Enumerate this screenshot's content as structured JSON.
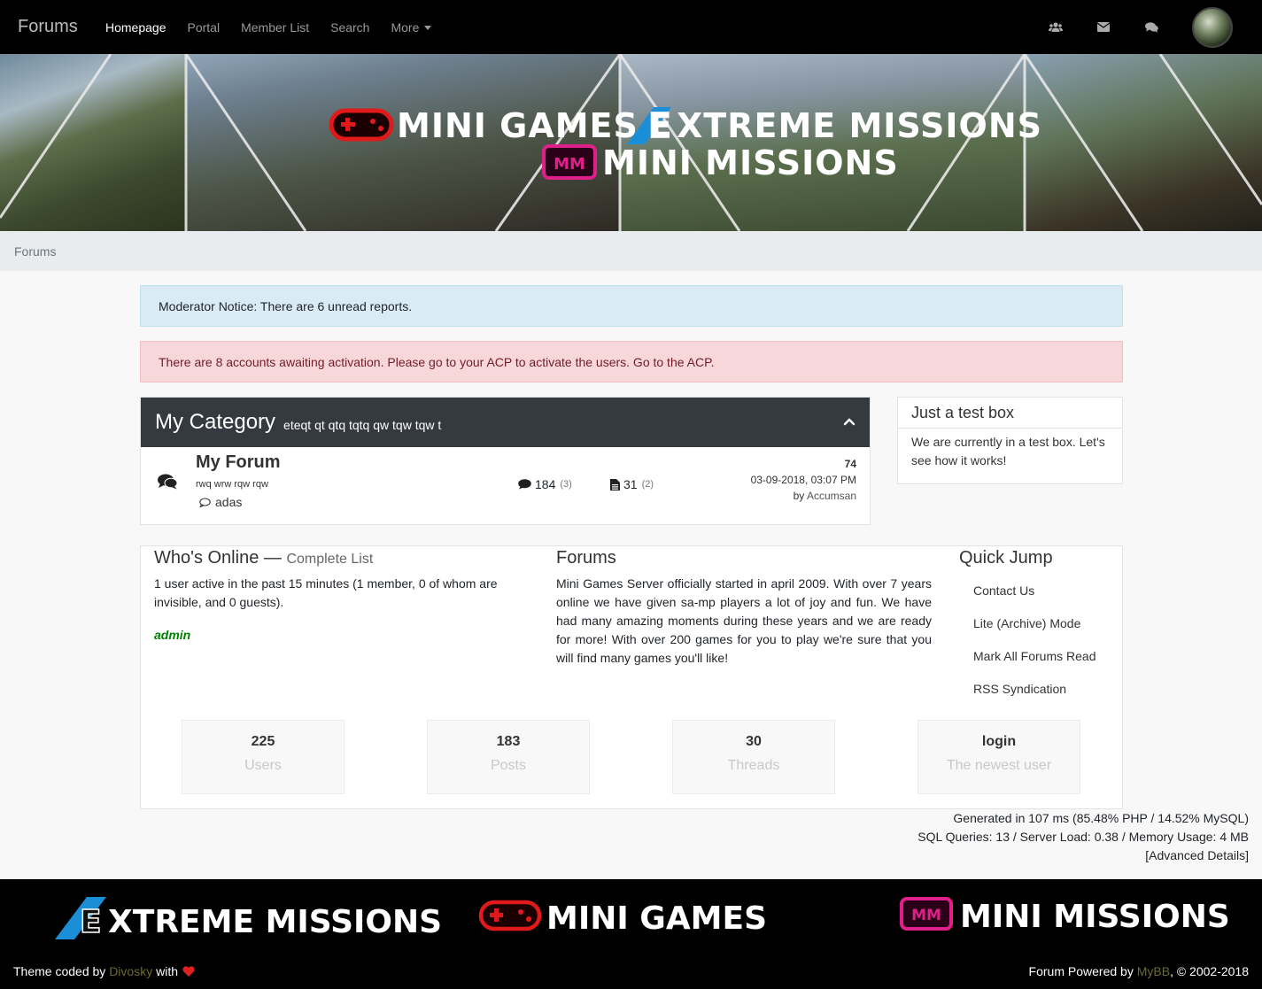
{
  "navbar": {
    "brand": "Forums",
    "links": [
      {
        "label": "Homepage",
        "active": true
      },
      {
        "label": "Portal"
      },
      {
        "label": "Member List"
      },
      {
        "label": "Search"
      },
      {
        "label": "More"
      }
    ],
    "icons": [
      "users-icon",
      "envelope-icon",
      "comments-icon"
    ]
  },
  "banner": {
    "line1_left": "MINI GAMES",
    "line1_right": "XTREME MISSIONS",
    "line1_right_initial": "E",
    "line2": "MINI MISSIONS",
    "mm_badge": "MM"
  },
  "breadcrumb": "Forums",
  "alerts": {
    "info": "Moderator Notice: There are 6 unread reports.",
    "danger": "There are 8 accounts awaiting activation. Please go to your ACP to activate the users. Go to the ACP."
  },
  "category": {
    "title": "My Category",
    "description": "eteqt qt qtq tqtq qw tqw tqw t",
    "forum": {
      "name": "My Forum",
      "description": "rwq wrw rqw rqw",
      "subforum": "adas",
      "threads": "184",
      "threads_unapproved": "(3)",
      "posts": "31",
      "posts_unapproved": "(2)",
      "lastpost_title": "74",
      "lastpost_date": "03-09-2018, 03:07 PM",
      "lastpost_by": "by",
      "lastpost_user": "Accumsan"
    }
  },
  "sidebox": {
    "title": "Just a test box",
    "body": "We are currently in a test box. Let's see how it works!"
  },
  "whos_online": {
    "title": "Who's Online",
    "separator": "—",
    "link": "Complete List",
    "text": "1 user active in the past 15 minutes (1 member, 0 of whom are invisible, and 0 guests).",
    "user": "admin"
  },
  "forums_info": {
    "title": "Forums",
    "text": "Mini Games Server officially started in april 2009. With over 7 years online we have given sa-mp players a lot of joy and fun. We have had many amazing moments during these years and we are ready for more! With over 200 games for you to play we're sure that you will find many games you'll like!"
  },
  "quick_jump": {
    "title": "Quick Jump",
    "items": [
      "Contact Us",
      "Lite (Archive) Mode",
      "Mark All Forums Read",
      "RSS Syndication"
    ]
  },
  "stats": [
    {
      "value": "225",
      "label": "Users"
    },
    {
      "value": "183",
      "label": "Posts"
    },
    {
      "value": "30",
      "label": "Threads"
    },
    {
      "value": "login",
      "label": "The newest user"
    }
  ],
  "debug": {
    "line1": "Generated in 107 ms (85.48% PHP / 14.52% MySQL)",
    "line2": "SQL Queries: 13 / Server Load: 0.38 / Memory Usage: 4 MB",
    "open_bracket": "[",
    "link": "Advanced Details",
    "close_bracket": "]"
  },
  "footer": {
    "logo1_initial": "E",
    "logo1": "XTREME MISSIONS",
    "logo2": "MINI GAMES",
    "logo3": "MINI MISSIONS",
    "mm_badge": "MM",
    "credit_prefix": "Theme coded by",
    "credit_author": "Divosky",
    "credit_with": "with",
    "powered_prefix": "Forum Powered by",
    "powered_link": "MyBB",
    "powered_suffix": ", © 2002-2018"
  },
  "colors": {
    "navbar": "#000000",
    "category_header": "#343a40",
    "info_bg": "#d9ecf6",
    "danger_bg": "#f8d7da",
    "online_user": "#008000",
    "gamepad_red": "#e01a1a",
    "mm_pink": "#e0208a",
    "extreme_blue": "#1a8fd8"
  }
}
